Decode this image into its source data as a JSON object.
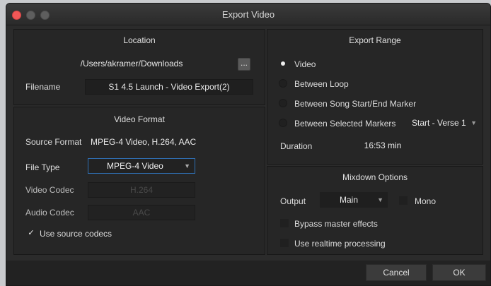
{
  "window": {
    "title": "Export Video"
  },
  "location": {
    "heading": "Location",
    "path": "/Users/akramer/Downloads",
    "browse_label": "...",
    "filename_label": "Filename",
    "filename": "S1 4.5 Launch - Video Export(2)"
  },
  "video_format": {
    "heading": "Video Format",
    "source_format_label": "Source Format",
    "source_format": "MPEG-4 Video, H.264, AAC",
    "file_type_label": "File Type",
    "file_type": "MPEG-4 Video",
    "video_codec_label": "Video Codec",
    "video_codec": "H.264",
    "audio_codec_label": "Audio Codec",
    "audio_codec": "AAC",
    "use_source_codecs_label": "Use source codecs",
    "use_source_codecs_checked": true
  },
  "export_range": {
    "heading": "Export Range",
    "options": [
      {
        "label": "Video",
        "selected": true
      },
      {
        "label": "Between Loop",
        "selected": false
      },
      {
        "label": "Between Song Start/End Marker",
        "selected": false
      },
      {
        "label": "Between Selected Markers",
        "selected": false
      }
    ],
    "marker_select": "Start - Verse 1",
    "duration_label": "Duration",
    "duration": "16:53 min"
  },
  "mixdown": {
    "heading": "Mixdown Options",
    "output_label": "Output",
    "output_value": "Main",
    "mono_label": "Mono",
    "bypass_label": "Bypass master effects",
    "realtime_label": "Use realtime processing"
  },
  "footer": {
    "cancel_label": "Cancel",
    "ok_label": "OK"
  },
  "colors": {
    "accent": "#2f6fb3",
    "close": "#f25757"
  }
}
